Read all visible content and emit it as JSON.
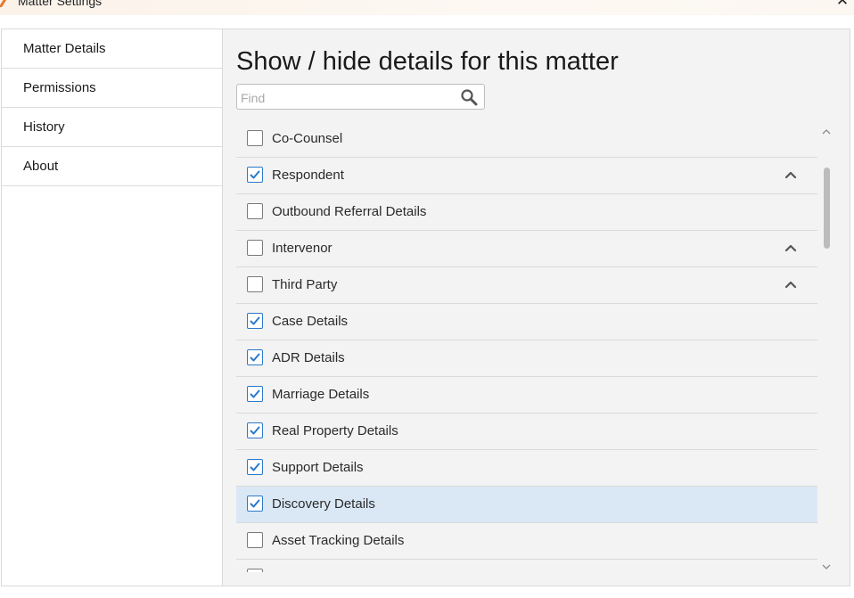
{
  "window": {
    "title": "Matter Settings",
    "close_symbol": "✕"
  },
  "sidebar": {
    "items": [
      {
        "label": "Matter Details"
      },
      {
        "label": "Permissions"
      },
      {
        "label": "History"
      },
      {
        "label": "About"
      }
    ]
  },
  "main": {
    "heading": "Show / hide details for this matter",
    "search": {
      "placeholder": "Find",
      "value": "",
      "icon": "search-icon"
    },
    "rows": [
      {
        "label": "Co-Counsel",
        "checked": false,
        "expandable": false,
        "selected": false
      },
      {
        "label": "Respondent",
        "checked": true,
        "expandable": true,
        "selected": false
      },
      {
        "label": "Outbound Referral Details",
        "checked": false,
        "expandable": false,
        "selected": false
      },
      {
        "label": "Intervenor",
        "checked": false,
        "expandable": true,
        "selected": false
      },
      {
        "label": "Third Party",
        "checked": false,
        "expandable": true,
        "selected": false
      },
      {
        "label": "Case Details",
        "checked": true,
        "expandable": false,
        "selected": false
      },
      {
        "label": "ADR Details",
        "checked": true,
        "expandable": false,
        "selected": false
      },
      {
        "label": "Marriage Details",
        "checked": true,
        "expandable": false,
        "selected": false
      },
      {
        "label": "Real Property Details",
        "checked": true,
        "expandable": false,
        "selected": false
      },
      {
        "label": "Support Details",
        "checked": true,
        "expandable": false,
        "selected": false
      },
      {
        "label": "Discovery Details",
        "checked": true,
        "expandable": false,
        "selected": true
      },
      {
        "label": "Asset Tracking Details",
        "checked": false,
        "expandable": false,
        "selected": false
      },
      {
        "label": "",
        "checked": false,
        "expandable": false,
        "selected": false
      }
    ]
  },
  "colors": {
    "accent": "#2b79c9",
    "selected_row": "#dae8f6",
    "brand_icon": "#e8762c"
  }
}
